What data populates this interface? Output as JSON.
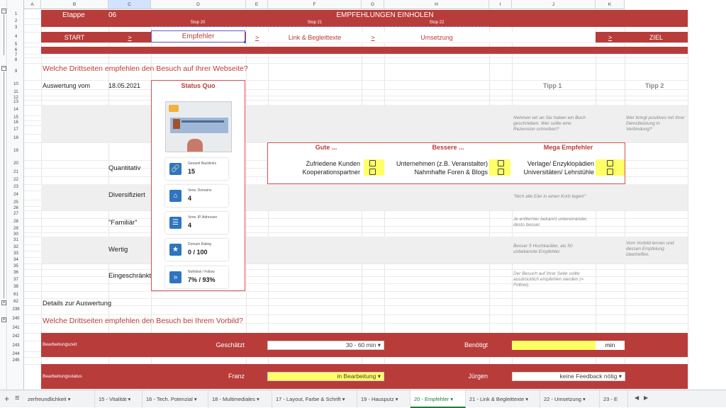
{
  "columns": [
    "A",
    "B",
    "C",
    "D",
    "E",
    "F",
    "G",
    "H",
    "I",
    "J",
    "K"
  ],
  "rows": [
    "1",
    "2",
    "3",
    "4",
    "5",
    "6",
    "7",
    "8",
    "9",
    "10",
    "11",
    "12",
    "13",
    "14",
    "15",
    "16",
    "17",
    "18",
    "19",
    "20",
    "21",
    "22",
    "23",
    "24",
    "25",
    "26",
    "27",
    "28",
    "29",
    "30",
    "31",
    "32",
    "33",
    "34",
    "35",
    "36",
    "37",
    "38",
    "61",
    "62",
    "239",
    "240",
    "241",
    "242",
    "243",
    "244",
    "245"
  ],
  "header": {
    "etappe_label": "Etappe",
    "etappe_num": "06",
    "title": "EMPFEHLUNGEN EINHOLEN",
    "stop20": "Stop 20",
    "stop21": "Stop 21",
    "stop22": "Stop 22"
  },
  "nav": {
    "start": "START",
    "arrow1": ">",
    "empfehler": "Empfehler",
    "arrow2": ">",
    "link": "Link & Begleittexte",
    "arrow3": ">",
    "umsetzung": "Umsetzung",
    "arrow4": ">",
    "ziel": "ZIEL"
  },
  "question1": "Welche Drittseiten empfehlen den Besuch auf Ihrer Webseite?",
  "auswertung_label": "Auswertung vom",
  "auswertung_date": "18.05.2021",
  "status_quo": "Status Quo",
  "tipp1": "Tipp 1",
  "tipp2": "Tipp 2",
  "metrics": [
    {
      "label": "Gesamt Backlinks",
      "value": "15",
      "icon": "link-icon"
    },
    {
      "label": "Verw. Domains",
      "value": "4",
      "icon": "home-icon"
    },
    {
      "label": "Verw. IP-Adressen",
      "value": "4",
      "icon": "list-icon"
    },
    {
      "label": "Domain Rating",
      "value": "0 / 100",
      "icon": "star-icon"
    },
    {
      "label": "Nofollow / Follow",
      "value": "7% / 93%",
      "icon": "double-chevron-icon"
    }
  ],
  "criteria": {
    "quantitativ": "Quantitativ",
    "diversifiziert": "Diversifiziert",
    "familiar": "\"Familiär\"",
    "wertig": "Wertig",
    "eingeschraenkt": "Eingeschränkt"
  },
  "details": "Details zur Auswertung",
  "empfehler_table": {
    "gute": "Gute ...",
    "bessere": "Bessere ...",
    "mega": "Mega Empfehler",
    "g1": "Zufriedene Kunden",
    "g2": "Kooperationspartner",
    "b1": "Unternehmen (z.B. Veranstalter)",
    "b2": "Nahmhafte Foren & Blogs",
    "m1": "Verlage/ Enzyklopädien",
    "m2": "Universitäten/ Lehrstühle"
  },
  "notes": {
    "n1": "Nehmen wir an Sie haben ein Buch geschrieben. Wer sollte eine Rezension schreiben?",
    "n2": "Wer bringt positives mit Ihrer Dienstleistung in Verbindung?",
    "n3": "\"Nich alle Eier in einen Korb legen!\"",
    "n4": "Je entfernter bekannt untereinander, desto besser.",
    "n5": "Besser 5 Hochkaräter, als 50 unbekannte Empfehler.",
    "n6": "Vom Vorbild lernen und dessen Empfelung übertreffen.",
    "n7": "Der Besuch auf Ihrer Seite sollte ausdrücklich empfehlen werden (= Follow)."
  },
  "question2": "Welche Drittseiten empfehlen den Besuch bei Ihrem Vorbild?",
  "bottom": {
    "bearbeitungszeit": "Bearbeitungszeit",
    "geschaetzt": "Geschätzt",
    "geschaetzt_val": "30 - 60 min",
    "benoetigt": "Benötigt",
    "min": "min",
    "bearbeitungsstatus": "Bearbeitungsstatus",
    "franz": "Franz",
    "franz_val": "in Bearbeitung",
    "juergen": "Jürgen",
    "juergen_val": "keine Feedback nötig"
  },
  "tabs": [
    "zerfreundlichkeit",
    "15 - Vitalität",
    "16 - Tech. Potenzial",
    "18 - Multimediales",
    "17 - Layout, Farbe & Schrift",
    "19 - Hausputz",
    "20 - Empfehler",
    "21 - Link & Begleittexte",
    "22 - Umsetzung",
    "23 - E"
  ],
  "colors": {
    "band": "#b83c3a",
    "accent_red": "#c0392b",
    "highlight": "#ffff66",
    "link_blue": "#2f74c0"
  }
}
